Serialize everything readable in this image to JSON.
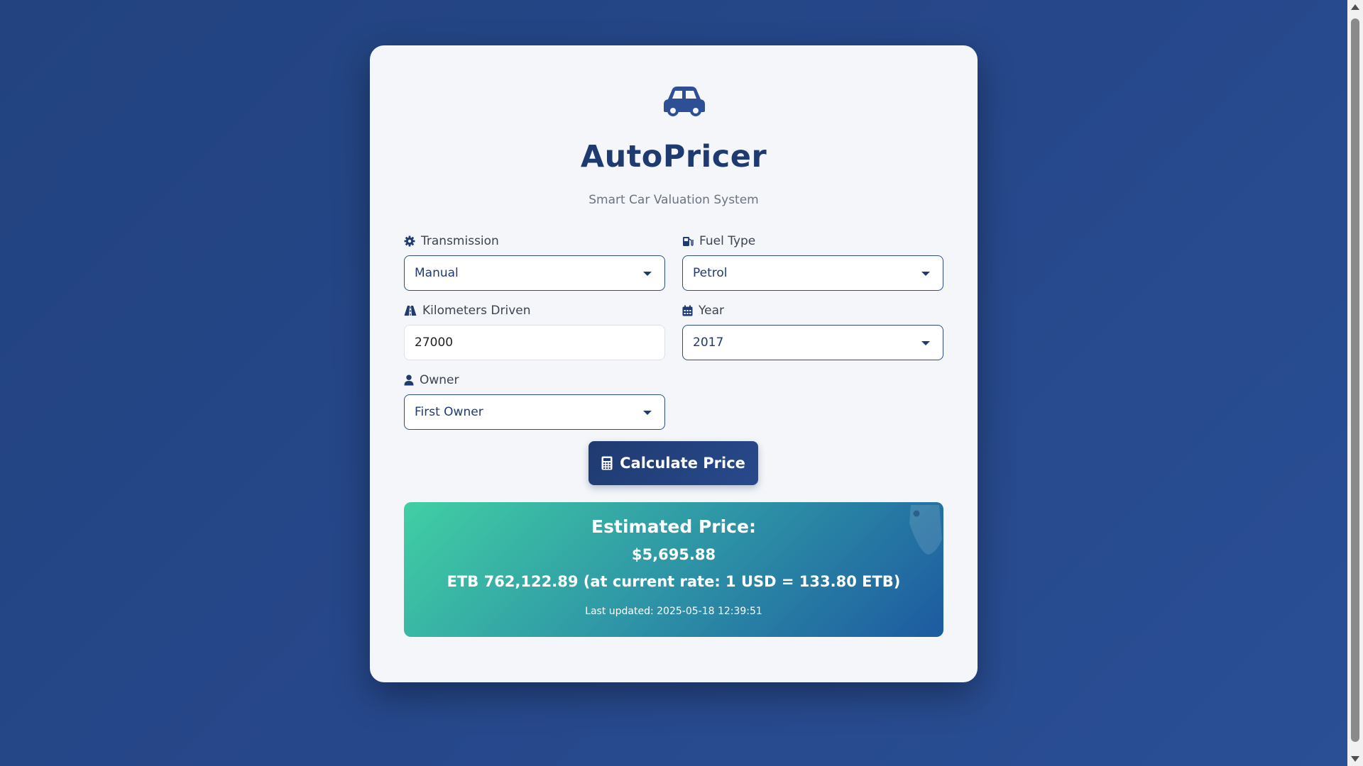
{
  "app": {
    "title": "AutoPricer",
    "subtitle": "Smart Car Valuation System",
    "icon": "car-icon"
  },
  "form": {
    "transmission": {
      "label": "Transmission",
      "value": "Manual",
      "icon": "gear-icon"
    },
    "fuel_type": {
      "label": "Fuel Type",
      "value": "Petrol",
      "icon": "gas-pump-icon"
    },
    "kilometers": {
      "label": "Kilometers Driven",
      "value": "27000",
      "icon": "road-icon"
    },
    "year": {
      "label": "Year",
      "value": "2017",
      "icon": "calendar-icon"
    },
    "owner": {
      "label": "Owner",
      "value": "First Owner",
      "icon": "user-icon"
    }
  },
  "actions": {
    "calculate_label": "Calculate Price",
    "calculate_icon": "calculator-icon"
  },
  "result": {
    "title": "Estimated Price:",
    "usd": "$5,695.88",
    "etb": "ETB 762,122.89 (at current rate: 1 USD = 133.80 ETB)",
    "updated": "Last updated: 2025-05-18 12:39:51"
  },
  "colors": {
    "primary": "#1f3a70",
    "background": "#26478a",
    "result_gradient_start": "#41cfa4",
    "result_gradient_end": "#1d5aa0"
  }
}
